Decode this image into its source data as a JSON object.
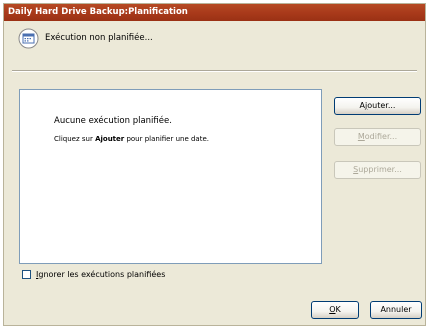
{
  "window": {
    "title": "Daily Hard Drive Backup:Planification"
  },
  "status": {
    "icon": "schedule-calendar-icon",
    "text": "Exécution non planifiée..."
  },
  "list": {
    "empty_title": "Aucune exécution planifiée.",
    "hint_prefix": "Cliquez sur ",
    "hint_bold": "Ajouter",
    "hint_suffix": " pour planifier une date."
  },
  "buttons": {
    "add_pre": "A",
    "add_ul": "j",
    "add_post": "outer...",
    "edit_ul": "M",
    "edit_post": "odifier...",
    "delete_ul": "S",
    "delete_post": "upprimer...",
    "ok_ul": "O",
    "ok_post": "K",
    "cancel": "Annuler"
  },
  "checkbox": {
    "label_ul": "I",
    "label_post": "gnorer les exécutions planifiées",
    "checked": false
  },
  "colors": {
    "titlebar": "#a8391a",
    "dialog_bg": "#ece9d8",
    "disabled_text": "#aca899"
  }
}
